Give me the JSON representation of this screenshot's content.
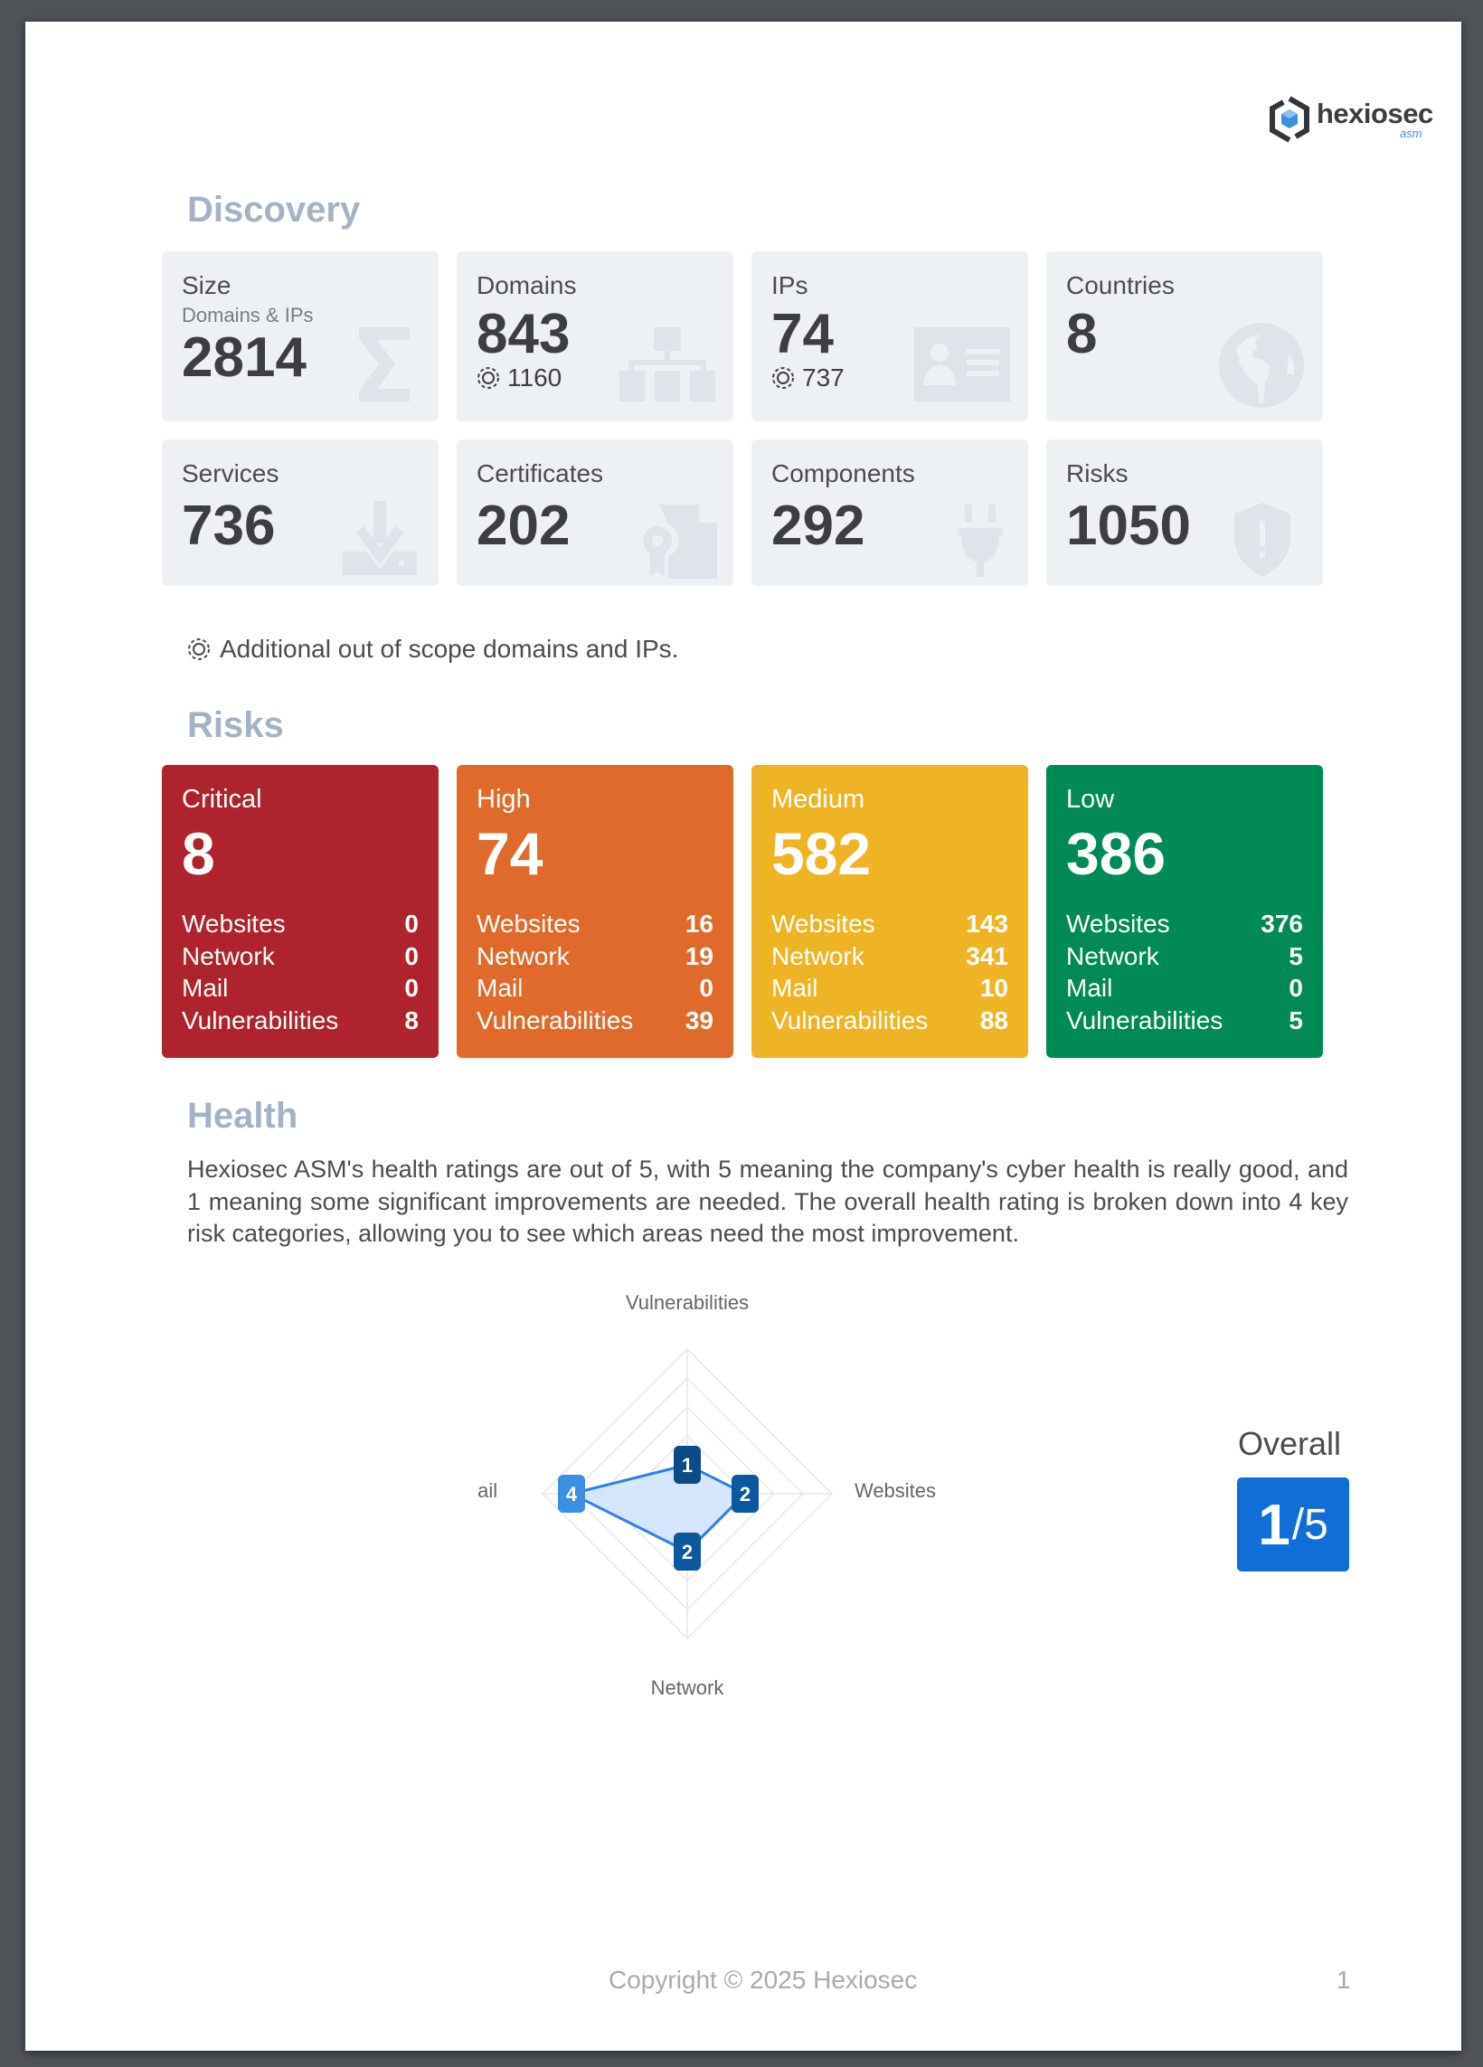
{
  "brand": {
    "name": "hexiosec",
    "sub": "asm",
    "accent": "#3a8fe0"
  },
  "discovery": {
    "title": "Discovery",
    "cards": [
      {
        "label": "Size",
        "sublabel": "Domains & IPs",
        "value": "2814",
        "icon": "sigma-icon"
      },
      {
        "label": "Domains",
        "value": "843",
        "extra": "1160",
        "icon": "sitemap-icon"
      },
      {
        "label": "IPs",
        "value": "74",
        "extra": "737",
        "icon": "id-card-icon"
      },
      {
        "label": "Countries",
        "value": "8",
        "icon": "globe-icon"
      },
      {
        "label": "Services",
        "value": "736",
        "icon": "download-icon"
      },
      {
        "label": "Certificates",
        "value": "202",
        "icon": "certificate-icon"
      },
      {
        "label": "Components",
        "value": "292",
        "icon": "plug-icon"
      },
      {
        "label": "Risks",
        "value": "1050",
        "icon": "shield-alert-icon"
      }
    ],
    "note": "Additional out of scope domains and IPs."
  },
  "risks": {
    "title": "Risks",
    "levels": [
      {
        "label": "Critical",
        "value": "8",
        "color": "#ae232d",
        "rows": [
          {
            "k": "Websites",
            "v": "0"
          },
          {
            "k": "Network",
            "v": "0"
          },
          {
            "k": "Mail",
            "v": "0"
          },
          {
            "k": "Vulnerabilities",
            "v": "8"
          }
        ]
      },
      {
        "label": "High",
        "value": "74",
        "color": "#e06a2c",
        "rows": [
          {
            "k": "Websites",
            "v": "16"
          },
          {
            "k": "Network",
            "v": "19"
          },
          {
            "k": "Mail",
            "v": "0"
          },
          {
            "k": "Vulnerabilities",
            "v": "39"
          }
        ]
      },
      {
        "label": "Medium",
        "value": "582",
        "color": "#efb426",
        "rows": [
          {
            "k": "Websites",
            "v": "143"
          },
          {
            "k": "Network",
            "v": "341"
          },
          {
            "k": "Mail",
            "v": "10"
          },
          {
            "k": "Vulnerabilities",
            "v": "88"
          }
        ]
      },
      {
        "label": "Low",
        "value": "386",
        "color": "#018a56",
        "rows": [
          {
            "k": "Websites",
            "v": "376"
          },
          {
            "k": "Network",
            "v": "5"
          },
          {
            "k": "Mail",
            "v": "0"
          },
          {
            "k": "Vulnerabilities",
            "v": "5"
          }
        ]
      }
    ]
  },
  "health": {
    "title": "Health",
    "description": "Hexiosec ASM's health ratings are out of 5, with 5 meaning the company's cyber health is really good, and 1 meaning some significant improvements are needed. The overall health rating is broken down into 4 key risk categories, allowing you to see which areas need the most improvement.",
    "overall_label": "Overall",
    "overall_value": "1",
    "overall_max": "/5"
  },
  "chart_data": {
    "type": "radar",
    "categories": [
      "Vulnerabilities",
      "Websites",
      "Network",
      "Mail"
    ],
    "values": [
      1,
      2,
      2,
      4
    ],
    "rlim": [
      0,
      5
    ],
    "grid": true,
    "point_colors": [
      "#0b4a86",
      "#0c57a0",
      "#0c57a0",
      "#3a8fe0"
    ],
    "line_color": "#2a7ff0",
    "fill_color": "#cfe2fb"
  },
  "footer": {
    "copyright": "Copyright © 2025 Hexiosec",
    "page": "1"
  }
}
